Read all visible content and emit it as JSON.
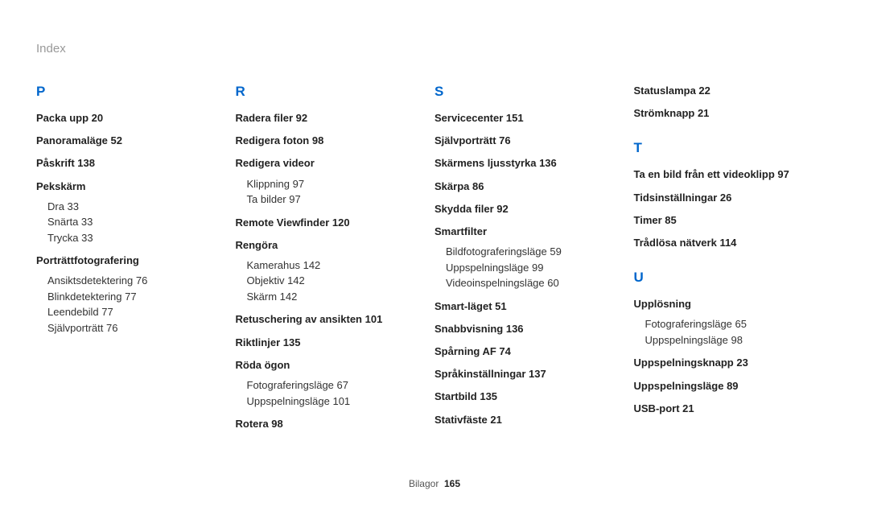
{
  "header": "Index",
  "footer": {
    "label": "Bilagor",
    "page": "165"
  },
  "cols": [
    {
      "sections": [
        {
          "letter": "P",
          "items": [
            {
              "t": "Packa upp  20",
              "b": true
            },
            {
              "t": "Panoramaläge  52",
              "b": true
            },
            {
              "t": "Påskrift  138",
              "b": true
            },
            {
              "t": "Pekskärm",
              "b": true,
              "sub": [
                "Dra  33",
                "Snärta  33",
                "Trycka  33"
              ]
            },
            {
              "t": "Porträttfotografering",
              "b": true,
              "sub": [
                "Ansiktsdetektering  76",
                "Blinkdetektering  77",
                "Leendebild  77",
                "Självporträtt  76"
              ]
            }
          ]
        }
      ]
    },
    {
      "sections": [
        {
          "letter": "R",
          "items": [
            {
              "t": "Radera filer  92",
              "b": true
            },
            {
              "t": "Redigera foton  98",
              "b": true
            },
            {
              "t": "Redigera videor",
              "b": true,
              "sub": [
                "Klippning  97",
                "Ta bilder  97"
              ]
            },
            {
              "t": "Remote Viewfinder  120",
              "b": true
            },
            {
              "t": "Rengöra",
              "b": true,
              "sub": [
                "Kamerahus  142",
                "Objektiv  142",
                "Skärm  142"
              ]
            },
            {
              "t": "Retuschering av ansikten  101",
              "b": true
            },
            {
              "t": "Riktlinjer  135",
              "b": true
            },
            {
              "t": "Röda ögon",
              "b": true,
              "sub": [
                "Fotograferingsläge  67",
                "Uppspelningsläge  101"
              ]
            },
            {
              "t": "Rotera  98",
              "b": true
            }
          ]
        }
      ]
    },
    {
      "sections": [
        {
          "letter": "S",
          "items": [
            {
              "t": "Servicecenter  151",
              "b": true
            },
            {
              "t": "Självporträtt  76",
              "b": true
            },
            {
              "t": "Skärmens ljusstyrka  136",
              "b": true
            },
            {
              "t": "Skärpa  86",
              "b": true
            },
            {
              "t": "Skydda filer  92",
              "b": true
            },
            {
              "t": "Smartfilter",
              "b": true,
              "sub": [
                "Bildfotograferingsläge  59",
                "Uppspelningsläge  99",
                "Videoinspelningsläge  60"
              ]
            },
            {
              "t": "Smart-läget  51",
              "b": true
            },
            {
              "t": "Snabbvisning  136",
              "b": true
            },
            {
              "t": "Spårning AF  74",
              "b": true
            },
            {
              "t": "Språkinställningar  137",
              "b": true
            },
            {
              "t": "Startbild  135",
              "b": true
            },
            {
              "t": "Stativfäste  21",
              "b": true
            }
          ]
        }
      ]
    },
    {
      "sections": [
        {
          "letter": "",
          "items": [
            {
              "t": "Statuslampa  22",
              "b": true
            },
            {
              "t": "Strömknapp  21",
              "b": true
            }
          ]
        },
        {
          "letter": "T",
          "items": [
            {
              "t": "Ta en bild från ett videoklipp  97",
              "b": true
            },
            {
              "t": "Tidsinställningar  26",
              "b": true
            },
            {
              "t": "Timer  85",
              "b": true
            },
            {
              "t": "Trådlösa nätverk  114",
              "b": true
            }
          ]
        },
        {
          "letter": "U",
          "items": [
            {
              "t": "Upplösning",
              "b": true,
              "sub": [
                "Fotograferingsläge  65",
                "Uppspelningsläge  98"
              ]
            },
            {
              "t": "Uppspelningsknapp  23",
              "b": true
            },
            {
              "t": "Uppspelningsläge  89",
              "b": true
            },
            {
              "t": "USB-port  21",
              "b": true
            }
          ]
        }
      ]
    }
  ]
}
